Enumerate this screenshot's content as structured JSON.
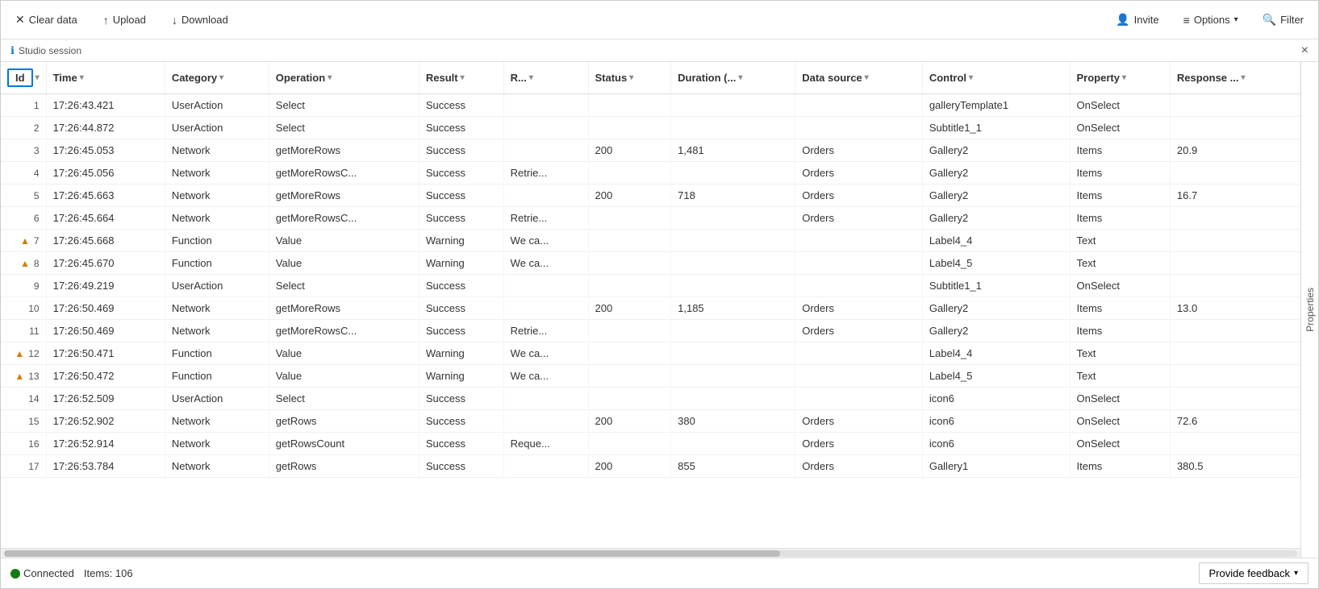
{
  "toolbar": {
    "clearData_label": "Clear data",
    "upload_label": "Upload",
    "download_label": "Download",
    "invite_label": "Invite",
    "options_label": "Options",
    "filter_label": "Filter"
  },
  "session": {
    "label": "Studio session",
    "close_label": "×"
  },
  "columns": [
    {
      "id": "id",
      "label": "Id",
      "sort": "▾"
    },
    {
      "id": "time",
      "label": "Time",
      "sort": "▾"
    },
    {
      "id": "category",
      "label": "Category",
      "sort": "▾"
    },
    {
      "id": "operation",
      "label": "Operation",
      "sort": "▾"
    },
    {
      "id": "result",
      "label": "Result",
      "sort": "▾"
    },
    {
      "id": "r",
      "label": "R...",
      "sort": "▾"
    },
    {
      "id": "status",
      "label": "Status",
      "sort": "▾"
    },
    {
      "id": "duration",
      "label": "Duration (..…",
      "sort": "▾"
    },
    {
      "id": "datasource",
      "label": "Data source",
      "sort": "▾"
    },
    {
      "id": "control",
      "label": "Control",
      "sort": "▾"
    },
    {
      "id": "property",
      "label": "Property",
      "sort": "▾"
    },
    {
      "id": "response",
      "label": "Response ...",
      "sort": "▾"
    }
  ],
  "rows": [
    {
      "id": 1,
      "warning": false,
      "time": "17:26:43.421",
      "category": "UserAction",
      "operation": "Select",
      "result": "Success",
      "r": "",
      "status": "",
      "duration": "",
      "datasource": "",
      "control": "galleryTemplate1",
      "property": "OnSelect",
      "response": ""
    },
    {
      "id": 2,
      "warning": false,
      "time": "17:26:44.872",
      "category": "UserAction",
      "operation": "Select",
      "result": "Success",
      "r": "",
      "status": "",
      "duration": "",
      "datasource": "",
      "control": "Subtitle1_1",
      "property": "OnSelect",
      "response": ""
    },
    {
      "id": 3,
      "warning": false,
      "time": "17:26:45.053",
      "category": "Network",
      "operation": "getMoreRows",
      "result": "Success",
      "r": "",
      "status": "200",
      "duration": "1,481",
      "datasource": "Orders",
      "control": "Gallery2",
      "property": "Items",
      "response": "20.9"
    },
    {
      "id": 4,
      "warning": false,
      "time": "17:26:45.056",
      "category": "Network",
      "operation": "getMoreRowsC...",
      "result": "Success",
      "r": "Retrie...",
      "status": "",
      "duration": "",
      "datasource": "Orders",
      "control": "Gallery2",
      "property": "Items",
      "response": ""
    },
    {
      "id": 5,
      "warning": false,
      "time": "17:26:45.663",
      "category": "Network",
      "operation": "getMoreRows",
      "result": "Success",
      "r": "",
      "status": "200",
      "duration": "718",
      "datasource": "Orders",
      "control": "Gallery2",
      "property": "Items",
      "response": "16.7"
    },
    {
      "id": 6,
      "warning": false,
      "time": "17:26:45.664",
      "category": "Network",
      "operation": "getMoreRowsC...",
      "result": "Success",
      "r": "Retrie...",
      "status": "",
      "duration": "",
      "datasource": "Orders",
      "control": "Gallery2",
      "property": "Items",
      "response": ""
    },
    {
      "id": 7,
      "warning": true,
      "time": "17:26:45.668",
      "category": "Function",
      "operation": "Value",
      "result": "Warning",
      "r": "We ca...",
      "status": "",
      "duration": "",
      "datasource": "",
      "control": "Label4_4",
      "property": "Text",
      "response": ""
    },
    {
      "id": 8,
      "warning": true,
      "time": "17:26:45.670",
      "category": "Function",
      "operation": "Value",
      "result": "Warning",
      "r": "We ca...",
      "status": "",
      "duration": "",
      "datasource": "",
      "control": "Label4_5",
      "property": "Text",
      "response": ""
    },
    {
      "id": 9,
      "warning": false,
      "time": "17:26:49.219",
      "category": "UserAction",
      "operation": "Select",
      "result": "Success",
      "r": "",
      "status": "",
      "duration": "",
      "datasource": "",
      "control": "Subtitle1_1",
      "property": "OnSelect",
      "response": ""
    },
    {
      "id": 10,
      "warning": false,
      "time": "17:26:50.469",
      "category": "Network",
      "operation": "getMoreRows",
      "result": "Success",
      "r": "",
      "status": "200",
      "duration": "1,185",
      "datasource": "Orders",
      "control": "Gallery2",
      "property": "Items",
      "response": "13.0"
    },
    {
      "id": 11,
      "warning": false,
      "time": "17:26:50.469",
      "category": "Network",
      "operation": "getMoreRowsC...",
      "result": "Success",
      "r": "Retrie...",
      "status": "",
      "duration": "",
      "datasource": "Orders",
      "control": "Gallery2",
      "property": "Items",
      "response": ""
    },
    {
      "id": 12,
      "warning": true,
      "time": "17:26:50.471",
      "category": "Function",
      "operation": "Value",
      "result": "Warning",
      "r": "We ca...",
      "status": "",
      "duration": "",
      "datasource": "",
      "control": "Label4_4",
      "property": "Text",
      "response": ""
    },
    {
      "id": 13,
      "warning": true,
      "time": "17:26:50.472",
      "category": "Function",
      "operation": "Value",
      "result": "Warning",
      "r": "We ca...",
      "status": "",
      "duration": "",
      "datasource": "",
      "control": "Label4_5",
      "property": "Text",
      "response": ""
    },
    {
      "id": 14,
      "warning": false,
      "time": "17:26:52.509",
      "category": "UserAction",
      "operation": "Select",
      "result": "Success",
      "r": "",
      "status": "",
      "duration": "",
      "datasource": "",
      "control": "icon6",
      "property": "OnSelect",
      "response": ""
    },
    {
      "id": 15,
      "warning": false,
      "time": "17:26:52.902",
      "category": "Network",
      "operation": "getRows",
      "result": "Success",
      "r": "",
      "status": "200",
      "duration": "380",
      "datasource": "Orders",
      "control": "icon6",
      "property": "OnSelect",
      "response": "72.6"
    },
    {
      "id": 16,
      "warning": false,
      "time": "17:26:52.914",
      "category": "Network",
      "operation": "getRowsCount",
      "result": "Success",
      "r": "Reque...",
      "status": "",
      "duration": "",
      "datasource": "Orders",
      "control": "icon6",
      "property": "OnSelect",
      "response": ""
    },
    {
      "id": 17,
      "warning": false,
      "time": "17:26:53.784",
      "category": "Network",
      "operation": "getRows",
      "result": "Success",
      "r": "",
      "status": "200",
      "duration": "855",
      "datasource": "Orders",
      "control": "Gallery1",
      "property": "Items",
      "response": "380.5"
    }
  ],
  "properties_sidebar": {
    "label": "Properties"
  },
  "status": {
    "connected_label": "Connected",
    "items_label": "Items: 106"
  },
  "feedback": {
    "label": "Provide feedback"
  }
}
